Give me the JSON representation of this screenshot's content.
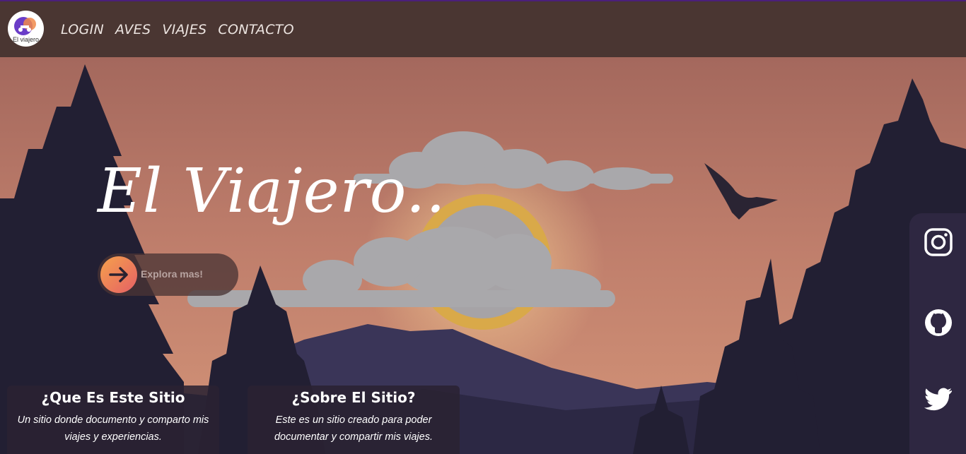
{
  "brand": {
    "logo_text": "El viajero"
  },
  "nav": {
    "items": [
      "LOGIN",
      "AVES",
      "VIAJES",
      "CONTACTO"
    ]
  },
  "hero": {
    "title": "El Viajero..",
    "cta_label": "Explora mas!"
  },
  "cards": [
    {
      "title": "¿Que Es Este Sitio",
      "text": "Un sitio donde documento y comparto mis viajes y experiencias."
    },
    {
      "title": "¿Sobre El Sitio?",
      "text": "Este es un sitio creado para poder documentar y compartir mis viajes."
    }
  ],
  "social": {
    "icons": [
      "instagram-icon",
      "github-icon",
      "twitter-icon"
    ]
  },
  "colors": {
    "navbar": "#4a3632",
    "sky": "#a86a5e",
    "sun_ring": "#d9a949",
    "trees": "#221f33",
    "mountain": "#3a3558",
    "cta_gradient_start": "#f5a14c",
    "cta_gradient_end": "#e56065"
  }
}
